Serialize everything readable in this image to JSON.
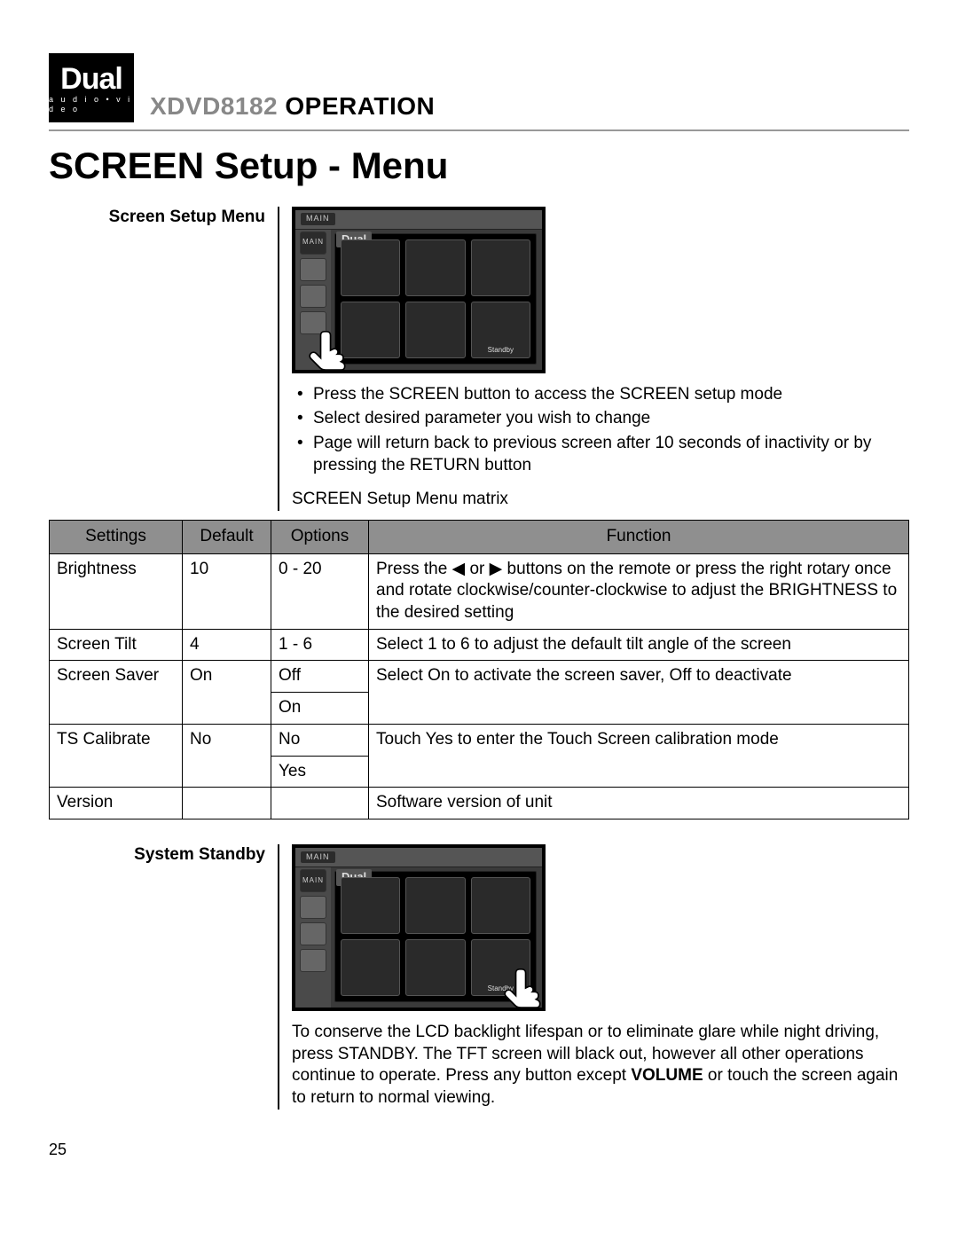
{
  "header": {
    "logo_main": "Dual",
    "logo_sub": "a u d i o • v i d e o",
    "model": "XDVD8182",
    "operation_word": "OPERATION"
  },
  "page_heading": "SCREEN Setup - Menu",
  "section1": {
    "label": "Screen Setup Menu",
    "screenshot": {
      "top_tag": "MAIN",
      "side_main": "MAIN",
      "brand": "Dual",
      "standby_label": "Standby"
    },
    "bullets": [
      "Press the SCREEN button to access the SCREEN setup mode",
      "Select desired parameter you wish to change",
      "Page will return back to previous screen after 10 seconds of inactivity or by pressing the RETURN button"
    ],
    "matrix_intro": "SCREEN Setup Menu matrix"
  },
  "table": {
    "headers": [
      "Settings",
      "Default",
      "Options",
      "Function"
    ],
    "rows": [
      {
        "setting": "Brightness",
        "default": "10",
        "options": [
          "0 - 20"
        ],
        "function_pre": "Press the ",
        "function_mid": " or ",
        "function_post": " buttons on the remote or press the right rotary once and rotate clockwise/counter-clockwise to adjust the BRIGHTNESS to the desired setting"
      },
      {
        "setting": "Screen Tilt",
        "default": "4",
        "options": [
          "1 - 6"
        ],
        "function": "Select 1 to 6 to adjust the default tilt angle of the screen"
      },
      {
        "setting": "Screen Saver",
        "default": "On",
        "options": [
          "Off",
          "On"
        ],
        "function": "Select On to activate the screen saver, Off to deactivate"
      },
      {
        "setting": "TS Calibrate",
        "default": "No",
        "options": [
          "No",
          "Yes"
        ],
        "function": "Touch Yes to enter the Touch Screen calibration mode"
      },
      {
        "setting": "Version",
        "default": "",
        "options": [
          ""
        ],
        "function": "Software version of unit"
      }
    ]
  },
  "section2": {
    "label": "System Standby",
    "paragraph_pre": "To conserve the LCD backlight lifespan or to eliminate glare while night driving, press STANDBY. The TFT screen will black out, however all other operations continue to operate. Press any button except ",
    "paragraph_bold": "VOLUME",
    "paragraph_post": " or touch the screen again to return to normal viewing."
  },
  "page_number": "25"
}
